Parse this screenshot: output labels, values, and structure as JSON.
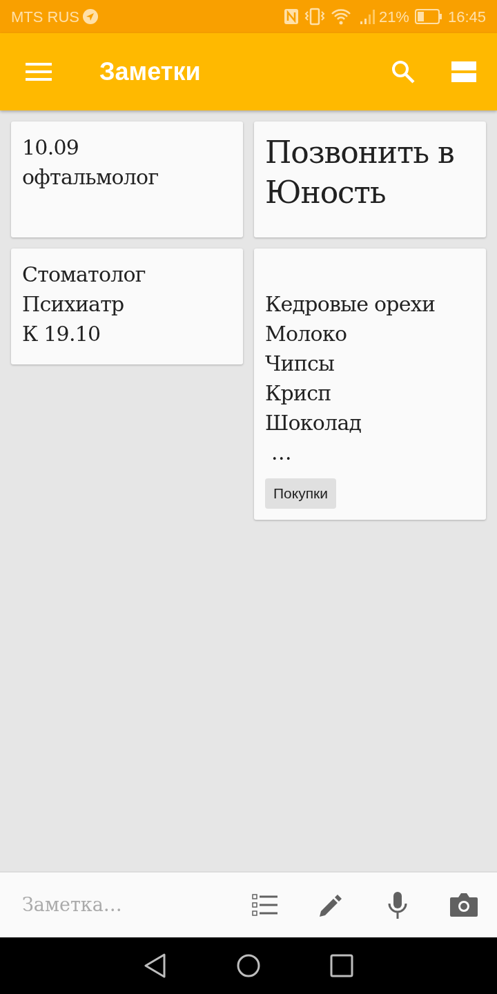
{
  "status_bar": {
    "carrier": "MTS RUS",
    "battery": "21%",
    "time": "16:45"
  },
  "app_bar": {
    "title": "Заметки"
  },
  "columns": [
    [
      {
        "kind": "normal",
        "leading_blank_line": false,
        "text": "10.09\nофтальмолог"
      },
      {
        "kind": "normal",
        "leading_blank_line": false,
        "text": "Стоматолог\nПсихиатр\nК 19.10"
      }
    ],
    [
      {
        "kind": "large",
        "leading_blank_line": false,
        "text": "Позвонить в Юность"
      },
      {
        "kind": "normal",
        "leading_blank_line": true,
        "text": "Кедровые орехи\nМолоко\nЧипсы\nКрисп\nШоколад\n …",
        "labels": [
          "Покупки"
        ]
      }
    ]
  ],
  "bottom_bar": {
    "placeholder": "Заметка…"
  }
}
